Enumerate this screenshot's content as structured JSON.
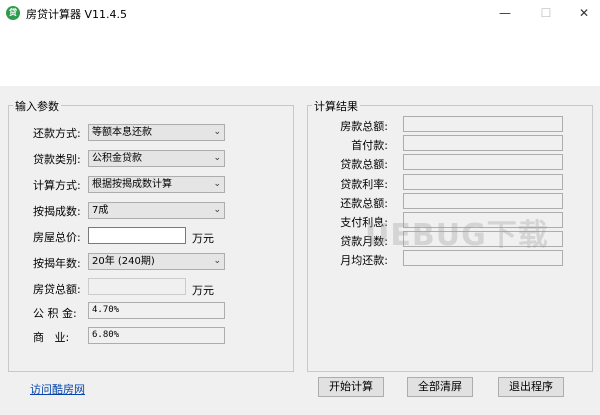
{
  "window": {
    "title": "房贷计算器 V11.4.5",
    "icon_text": "贷",
    "minimize_glyph": "—",
    "maximize_glyph": "☐",
    "close_glyph": "✕"
  },
  "input_group": {
    "title": "输入参数",
    "repayment_method": {
      "label": "还款方式:",
      "value": "等额本息还款"
    },
    "loan_type": {
      "label": "贷款类别:",
      "value": "公积金贷款"
    },
    "calc_method": {
      "label": "计算方式:",
      "value": "根据按揭成数计算"
    },
    "mortgage_ratio": {
      "label": "按揭成数:",
      "value": "7成"
    },
    "house_price": {
      "label": "房屋总价:",
      "value": "",
      "unit": "万元"
    },
    "mortgage_years": {
      "label": "按揭年数:",
      "value": "20年 (240期)"
    },
    "loan_total": {
      "label": "房贷总额:",
      "value": "",
      "unit": "万元"
    },
    "fund_rate": {
      "label": "公 积 金:",
      "value": "4.70%"
    },
    "commercial_rate": {
      "label": "商   业:",
      "value": "6.80%"
    }
  },
  "result_group": {
    "title": "计算结果",
    "rows": [
      {
        "label": "房款总额:",
        "value": ""
      },
      {
        "label": "首付款:",
        "value": ""
      },
      {
        "label": "贷款总额:",
        "value": ""
      },
      {
        "label": "贷款利率:",
        "value": ""
      },
      {
        "label": "还款总额:",
        "value": ""
      },
      {
        "label": "支付利息:",
        "value": ""
      },
      {
        "label": "贷款月数:",
        "value": ""
      },
      {
        "label": "月均还款:",
        "value": ""
      }
    ]
  },
  "footer": {
    "visit_link": "访问酷房网",
    "start_button": "开始计算",
    "clear_button": "全部清屏",
    "exit_button": "退出程序"
  },
  "watermark": "UEBUG下载"
}
